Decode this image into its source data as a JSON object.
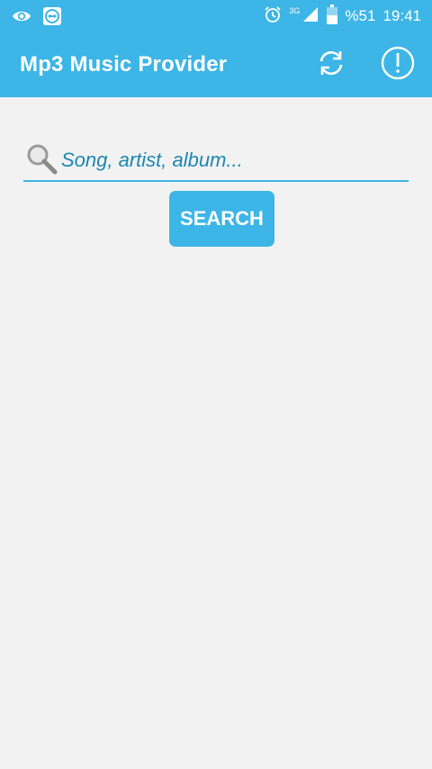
{
  "status_bar": {
    "left_icons": [
      "eye-icon",
      "teamviewer-icon"
    ],
    "right_icons": [
      "alarm-icon",
      "signal-icon",
      "battery-icon"
    ],
    "network_type": "3G",
    "battery_percent": "%51",
    "time": "19:41"
  },
  "toolbar": {
    "title": "Mp3 Music Provider",
    "actions": [
      "refresh-icon",
      "info-icon"
    ]
  },
  "search": {
    "placeholder": "Song, artist, album...",
    "value": "",
    "button_label": "SEARCH"
  },
  "colors": {
    "primary": "#3db5e6",
    "background": "#f2f2f2",
    "hint_text": "#1d87b0"
  }
}
